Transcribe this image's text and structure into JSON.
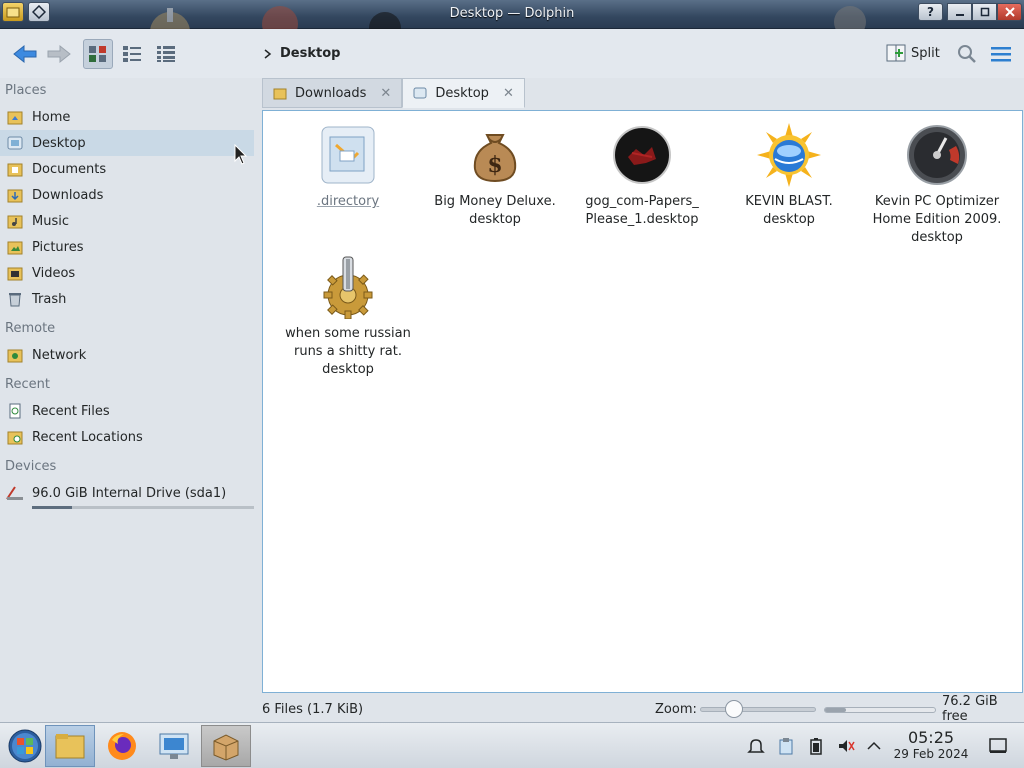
{
  "window": {
    "title": "Desktop — Dolphin"
  },
  "titlebar": {
    "help_label": "?",
    "icons": [
      "help-icon",
      "minimize-icon",
      "maximize-icon",
      "close-icon"
    ]
  },
  "toolbar": {
    "breadcrumb": "Desktop",
    "split_label": "Split"
  },
  "sidebar": {
    "places_header": "Places",
    "places": [
      "Home",
      "Desktop",
      "Documents",
      "Downloads",
      "Music",
      "Pictures",
      "Videos",
      "Trash"
    ],
    "remote_header": "Remote",
    "remote": [
      "Network"
    ],
    "recent_header": "Recent",
    "recent": [
      "Recent Files",
      "Recent Locations"
    ],
    "devices_header": "Devices",
    "devices": [
      "96.0 GiB Internal Drive (sda1)"
    ],
    "drive_usage_fraction": 0.18
  },
  "tabs": [
    {
      "label": "Downloads",
      "active": false
    },
    {
      "label": "Desktop",
      "active": true
    }
  ],
  "files": [
    {
      "name": ".directory",
      "icon": "settings-file-icon"
    },
    {
      "name": "Big Money Deluxe.\ndesktop",
      "icon": "money-bag-icon"
    },
    {
      "name": "gog_com-Papers_\nPlease_1.desktop",
      "icon": "papers-please-icon"
    },
    {
      "name": "KEVIN BLAST.\ndesktop",
      "icon": "sun-globe-icon"
    },
    {
      "name": "Kevin PC Optimizer\nHome Edition 2009.\ndesktop",
      "icon": "speedometer-icon"
    },
    {
      "name": "when some russian\nruns a shitty rat.\ndesktop",
      "icon": "gear-icon"
    }
  ],
  "status": {
    "summary": "6 Files (1.7 KiB)",
    "zoom_label": "Zoom:",
    "zoom_fraction": 0.25,
    "free_space": "76.2 GiB free",
    "used_fraction": 0.19
  },
  "clock": {
    "time": "05:25",
    "date": "29 Feb 2024"
  }
}
